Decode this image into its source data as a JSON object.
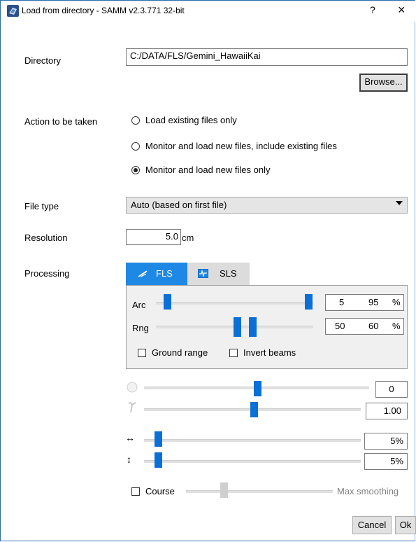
{
  "window": {
    "title": "Load from directory - SAMM v2.3.771 32-bit",
    "help_label": "?",
    "close_label": "×"
  },
  "directory": {
    "label": "Directory",
    "value": "C:/DATA/FLS/Gemini_HawaiiKai",
    "browse_label": "Browse..."
  },
  "action": {
    "label": "Action to be taken",
    "options": [
      {
        "label": "Load existing files only",
        "selected": false
      },
      {
        "label": "Monitor and load new files, include existing files",
        "selected": false
      },
      {
        "label": "Monitor and load new files only",
        "selected": true
      }
    ]
  },
  "file_type": {
    "label": "File type",
    "selected": "Auto (based on first file)"
  },
  "resolution": {
    "label": "Resolution",
    "value": "5.0",
    "unit": "cm"
  },
  "processing": {
    "label": "Processing",
    "tabs": [
      {
        "label": "FLS",
        "active": true,
        "icon": "sonar-icon"
      },
      {
        "label": "SLS",
        "active": false,
        "icon": "waveform-icon"
      }
    ],
    "arc": {
      "label": "Arc",
      "min": "5",
      "max": "95",
      "unit": "%",
      "min_value": 5,
      "max_value": 95
    },
    "rng": {
      "label": "Rng",
      "min": "50",
      "max": "60",
      "unit": "%",
      "min_value": 50,
      "max_value": 60
    },
    "ground_range_label": "Ground range",
    "invert_beams_label": "Invert beams"
  },
  "sliders": {
    "brightness": {
      "icon": "circle-icon",
      "value": "0",
      "level": 0.5
    },
    "gamma": {
      "icon": "gamma-icon",
      "value": "1.00",
      "level": 0.5
    },
    "horizontal": {
      "icon": "horizontal-arrows-icon",
      "value": "5%",
      "level": 0.05
    },
    "vertical": {
      "icon": "vertical-arrows-icon",
      "value": "5%",
      "level": 0.05
    }
  },
  "course": {
    "label": "Course",
    "max_label": "Max smoothing",
    "level": 0.3
  },
  "buttons": {
    "cancel_label": "Cancel",
    "ok_label": "Ok"
  }
}
